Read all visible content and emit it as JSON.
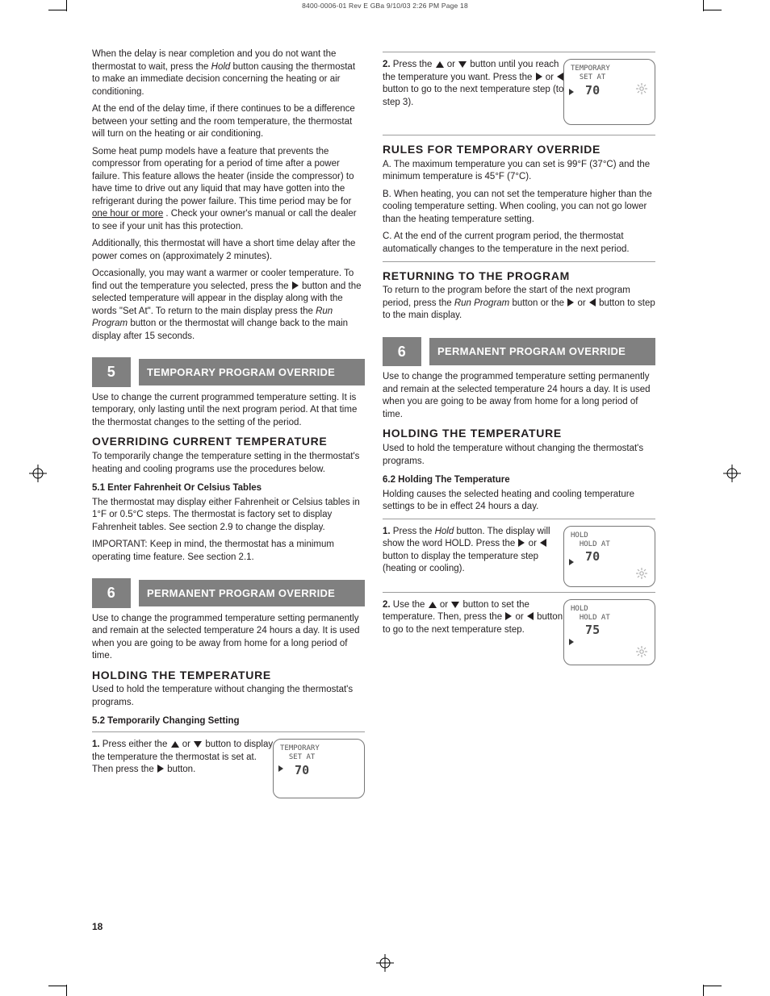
{
  "imprint": "8400-0006-01 Rev E GBa  9/10/03  2:26 PM  Page 18",
  "page_number": "18",
  "left": {
    "intro_1a": "When the delay is near completion and you do not want the thermostat to wait, press the ",
    "intro_1_em": "Hold",
    "intro_1b": " button causing the thermostat to make an immediate decision concerning the heating or air conditioning.",
    "intro_2a": "At the end of the delay time, if there continues to be a difference between your setting and the room temperature, the thermostat will turn on the heating or air conditioning.",
    "intro_2b_1": "Some heat pump models have a feature that prevents the compressor from operating for a period of time after a power failure. This feature allows the heater (inside the compressor) to have time to drive out any liquid that may have gotten into the refrigerant during the power failure. This time period may be for ",
    "intro_2b_u": "one hour or more",
    "intro_2b_2": ". Check your owner's manual or call the dealer to see if your unit has this protection.",
    "intro_2b_3": "Additionally, this thermostat will have a short time delay after the power comes on (approximately 2 minutes).",
    "intro_3a": "Occasionally, you may want a warmer or cooler temperature. To find out the temperature you selected, press the ",
    "intro_3_arrow": "right",
    "intro_3b": " button and the selected temperature will appear in the display along with the words \"Set At\". To return to the main display press the ",
    "intro_3b_em": "Run Program",
    "intro_3c": " button or the thermostat will change back to the main display after 15 seconds.",
    "sec5_num": "5",
    "sec5_title": "TEMPORARY PROGRAM OVERRIDE",
    "sec5_p1_a": "Use to change the current programmed temperature setting. It is temporary, only lasting until the next program period. At that time the thermostat changes to the setting of the period.",
    "sec5_override_h": "OVERRIDING CURRENT TEMPERATURE",
    "sec5_override_p1": "To temporarily change the temperature setting in the thermostat's heating and cooling programs use the procedures below.",
    "sec5_tables": "5.1 Enter Fahrenheit Or Celsius Tables",
    "sec5_tables_body": "The thermostat may display either Fahrenheit or Celsius tables in 1°F or 0.5°C steps. The thermostat is factory set to display Fahrenheit tables. See section 2.9 to change the display.",
    "sec5_important": "IMPORTANT: Keep in mind, the thermostat has a minimum operating time feature. See section 2.1.",
    "sec5_set_title": "5.2 Temporarily Changing Setting",
    "sec6_num": "6",
    "sec6_title": "PERMANENT PROGRAM OVERRIDE",
    "sec6_p1": "Use to change the programmed temperature setting permanently and remain at the selected temperature 24 hours a day. It is used when you are going to be away from home for a long period of time.",
    "holding_h": "HOLDING THE TEMPERATURE",
    "holding_p": "Used to hold the temperature without changing the thermostat's programs.",
    "steps_left": [
      {
        "n": "1.",
        "txt_a": "Press either the ",
        "u": true,
        "d": true,
        "txt_b": " button to display the temperature the thermostat is set at. Then press the ",
        "r": true,
        "txt_c": " button."
      },
      null
    ],
    "steps_right_top": [
      {
        "n": "2.",
        "txt_a": "Press the ",
        "u": true,
        "txt_b": " or ",
        "d": true,
        "txt_c": " button until you reach the temperature you want. Press the ",
        "r": true,
        "txt_d": " or ",
        "l": true,
        "txt_e": " button to go to the next temperature step (to step 3)."
      }
    ],
    "lcd_a_rows": [
      "TEMPORARY",
      "",
      "  SET AT",
      "  70"
    ],
    "rule_heading": "RULES FOR TEMPORARY OVERRIDE",
    "rule_a": "A. The maximum temperature you can set is 99°F (37°C) and the minimum temperature is 45°F (7°C).",
    "rule_b": "B. When heating, you can not set the temperature higher than the cooling temperature setting. When cooling, you can not go lower than the heating temperature setting.",
    "rule_c": "C. At the end of the current program period, the thermostat automatically changes to the temperature in the next period.",
    "returning_h": "RETURNING TO THE PROGRAM",
    "returning_p_a": "To return to the program before the start of the next program period, press the ",
    "returning_p_em": "Run Program",
    "returning_p_b": " button or the ",
    "returning_p_c": " or ",
    "returning_p_d": " button to step to the main display.",
    "sec62_title": "6.2 Holding The Temperature",
    "sec62_p": "Holding causes the selected heating and cooling temperature settings to be in effect 24 hours a day.",
    "step_r_1": {
      "n": "1.",
      "a": "Press the ",
      "em": "Hold",
      "b": " button. The display will show the word HOLD. Press the ",
      "r": true,
      "c": " or ",
      "l": true,
      "d": " button to display the temperature step (heating or cooling)."
    },
    "step_r_2": {
      "n": "2.",
      "a": "Use the ",
      "u": true,
      "b": " or ",
      "d": true,
      "c": " button to set the temperature. Then, press the ",
      "r": true,
      "c2": " or ",
      "l": true,
      "e": " button to go to the next temperature step."
    },
    "lcd_b_rows": [
      "HOLD",
      "",
      "  HOLD AT",
      "  70"
    ],
    "lcd_c_rows": [
      "HOLD",
      "",
      "  HOLD AT",
      "  75"
    ]
  }
}
